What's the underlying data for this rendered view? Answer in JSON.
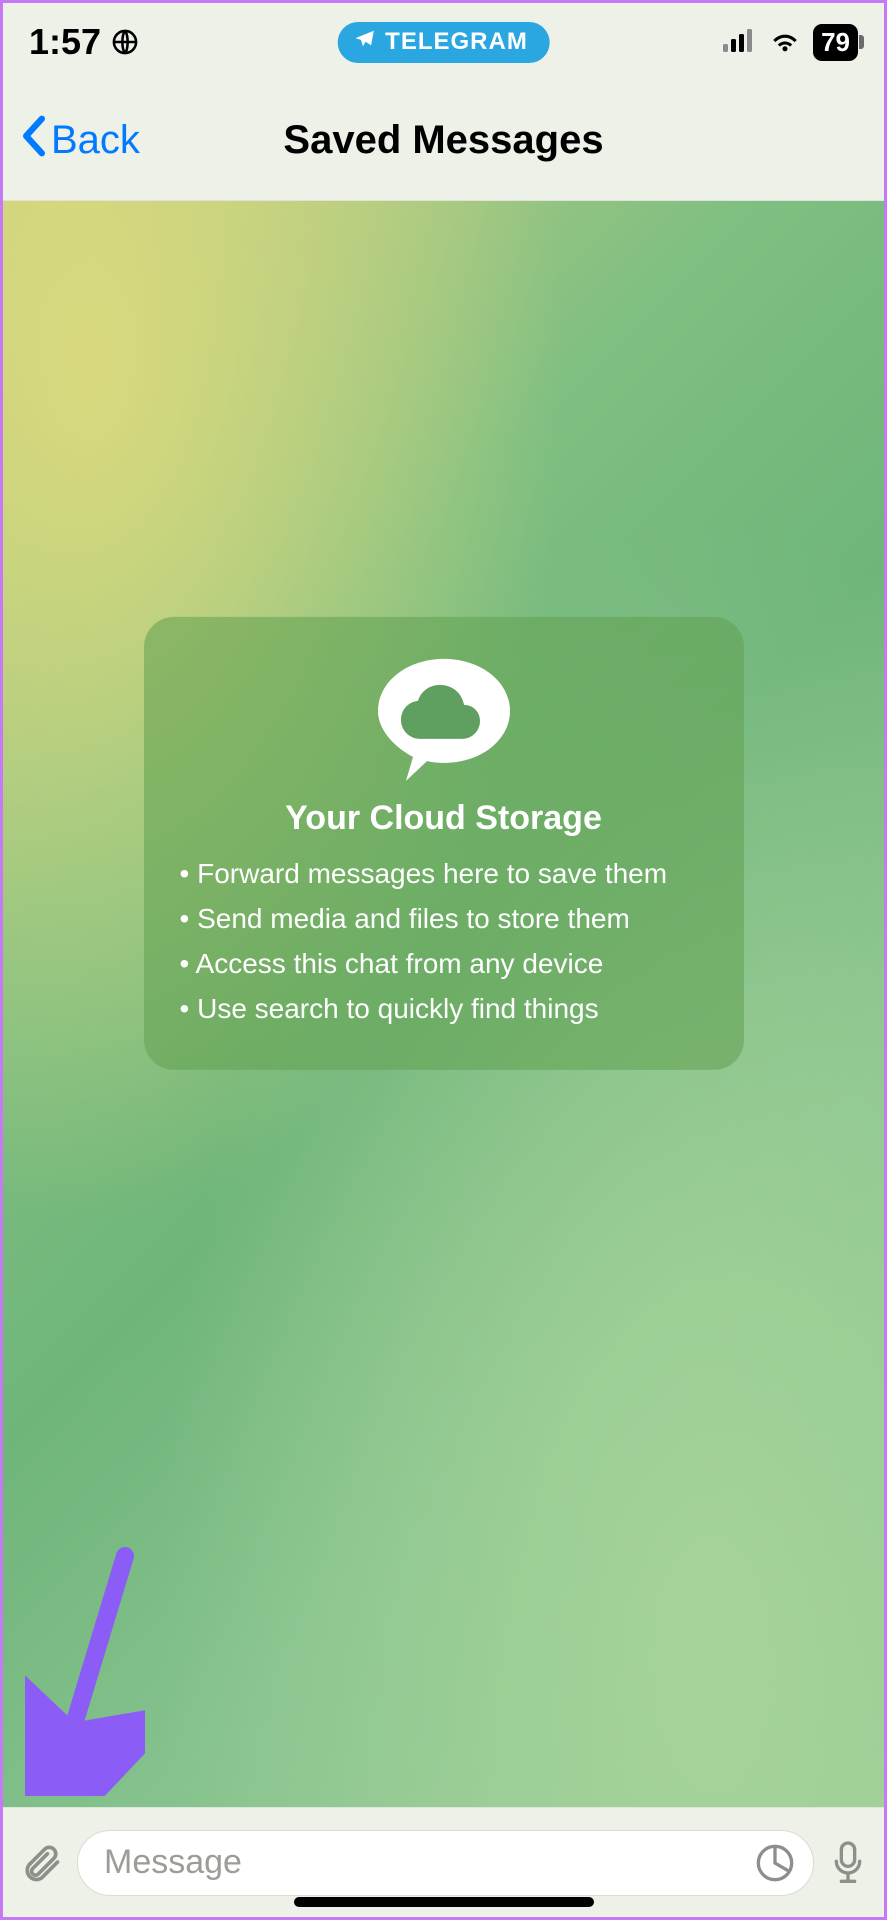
{
  "status": {
    "time": "1:57",
    "battery": "79",
    "pill_label": "TELEGRAM"
  },
  "nav": {
    "back_label": "Back",
    "title": "Saved Messages"
  },
  "info": {
    "title": "Your Cloud Storage",
    "items": [
      "Forward messages here to save them",
      "Send media and files to store them",
      "Access this chat from any device",
      "Use search to quickly find things"
    ]
  },
  "input": {
    "placeholder": "Message"
  },
  "colors": {
    "accent_blue": "#007aff",
    "pill_blue": "#2aa6e0",
    "annotation_purple": "#8b5cf6"
  }
}
